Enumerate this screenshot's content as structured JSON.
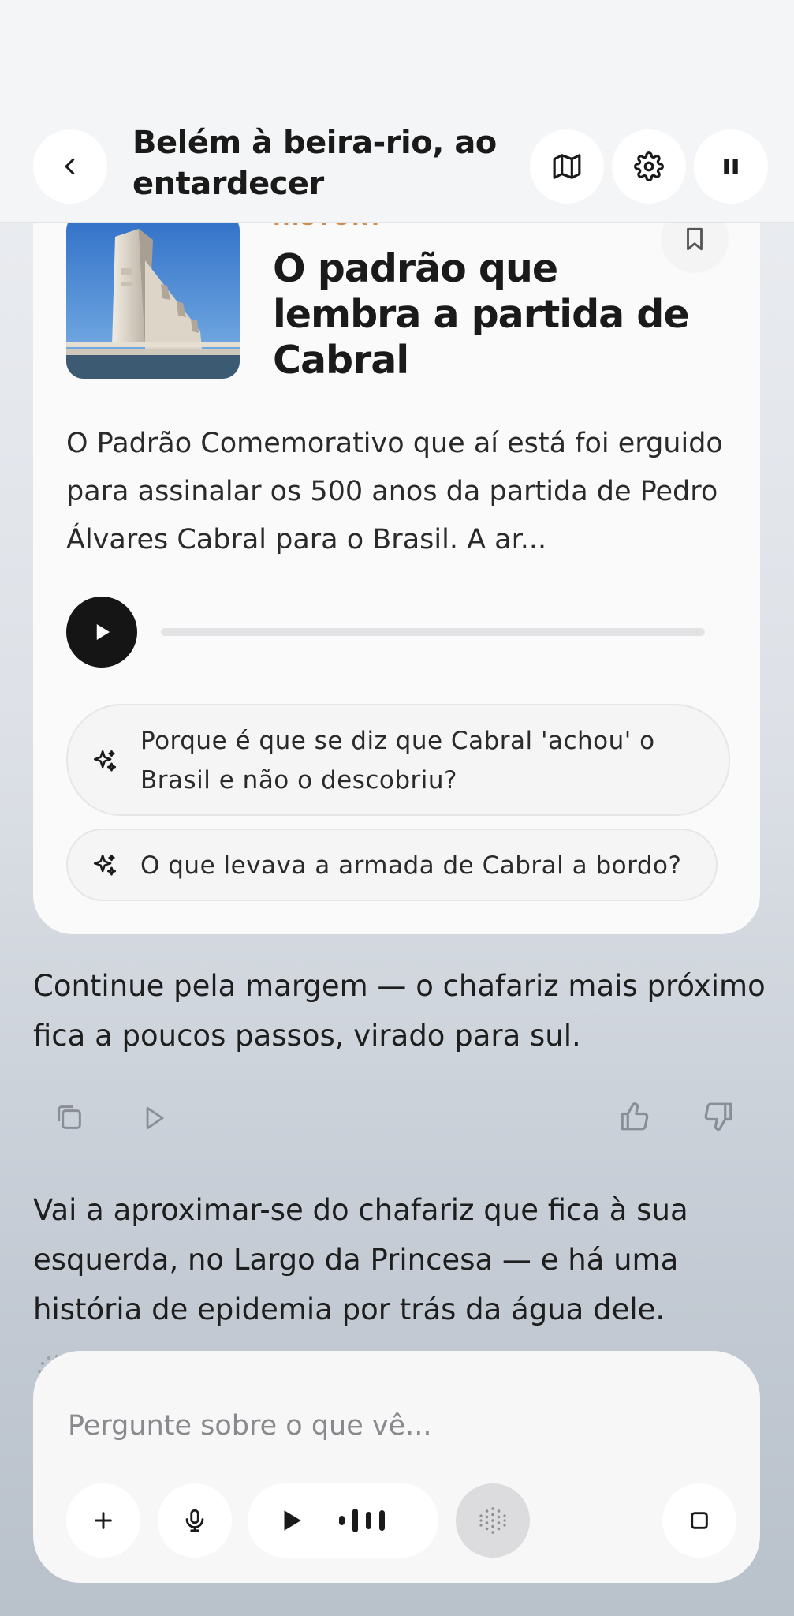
{
  "header": {
    "title": "Belém à beira-rio, ao entardecer",
    "icons": [
      "chevron-left-icon",
      "map-icon",
      "gear-icon",
      "pause-icon"
    ]
  },
  "story_card": {
    "category": "HISTORY",
    "title": "O padrão que lembra a partida de Cabral",
    "body": "O Padrão Comemorativo que aí está foi erguido para assinalar os 500 anos da partida de Pedro Álvares Cabral para o Brasil. A ar...",
    "audio_progress": 0,
    "suggestions": [
      "Porque é que se diz que Cabral 'achou' o Brasil e não o descobriu?",
      "O que levava a armada de Cabral a bordo?"
    ]
  },
  "messages": [
    "Continue pela margem — o chafariz mais próximo fica a poucos passos, virado para sul.",
    "Vai a aproximar-se do chafariz que fica à sua esquerda, no Largo da Princesa — e há uma história de epidemia por trás da água dele."
  ],
  "message_actions": [
    "copy-icon",
    "play-icon",
    "thumbs-up-icon",
    "thumbs-down-icon"
  ],
  "input": {
    "placeholder": "Pergunte sobre o que vê..."
  },
  "colors": {
    "accent": "#d08a4a",
    "play_button": "#151515",
    "card": "#fafafa"
  }
}
